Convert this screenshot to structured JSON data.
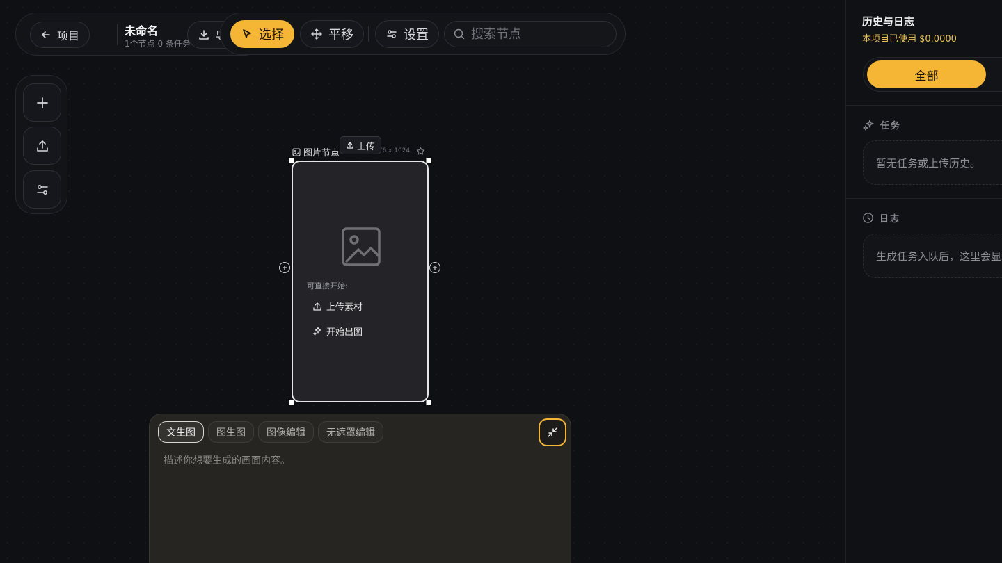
{
  "project": {
    "back_label": "项目",
    "title": "未命名",
    "subtitle": "1个节点 0 条任务",
    "export_label": "导出"
  },
  "toolbar": {
    "select_label": "选择",
    "pan_label": "平移",
    "settings_label": "设置",
    "search_placeholder": "搜索节点"
  },
  "side_tools": {
    "icons": [
      "plus-icon",
      "upload-icon",
      "sliders-icon"
    ]
  },
  "node": {
    "label": "图片节点",
    "dims": "576 x 1024",
    "upload_tag": "上传",
    "start_label": "可直接开始:",
    "action_upload": "上传素材",
    "action_generate": "开始出图"
  },
  "prompt": {
    "tabs": [
      {
        "label": "文生图",
        "active": true
      },
      {
        "label": "图生图",
        "active": false
      },
      {
        "label": "图像编辑",
        "active": false
      },
      {
        "label": "无遮罩编辑",
        "active": false
      }
    ],
    "placeholder": "描述你想要生成的画面内容。"
  },
  "sidebar": {
    "title": "历史与日志",
    "cost": "本项目已使用 $0.0000",
    "filter_all": "全部",
    "tasks_title": "任务",
    "tasks_empty": "暂无任务或上传历史。",
    "logs_title": "日志",
    "logs_empty": "生成任务入队后，这里会显示"
  },
  "colors": {
    "accent": "#f5b535",
    "background": "#0e1014",
    "panel": "#121418",
    "cost_text": "#e9c25a"
  }
}
